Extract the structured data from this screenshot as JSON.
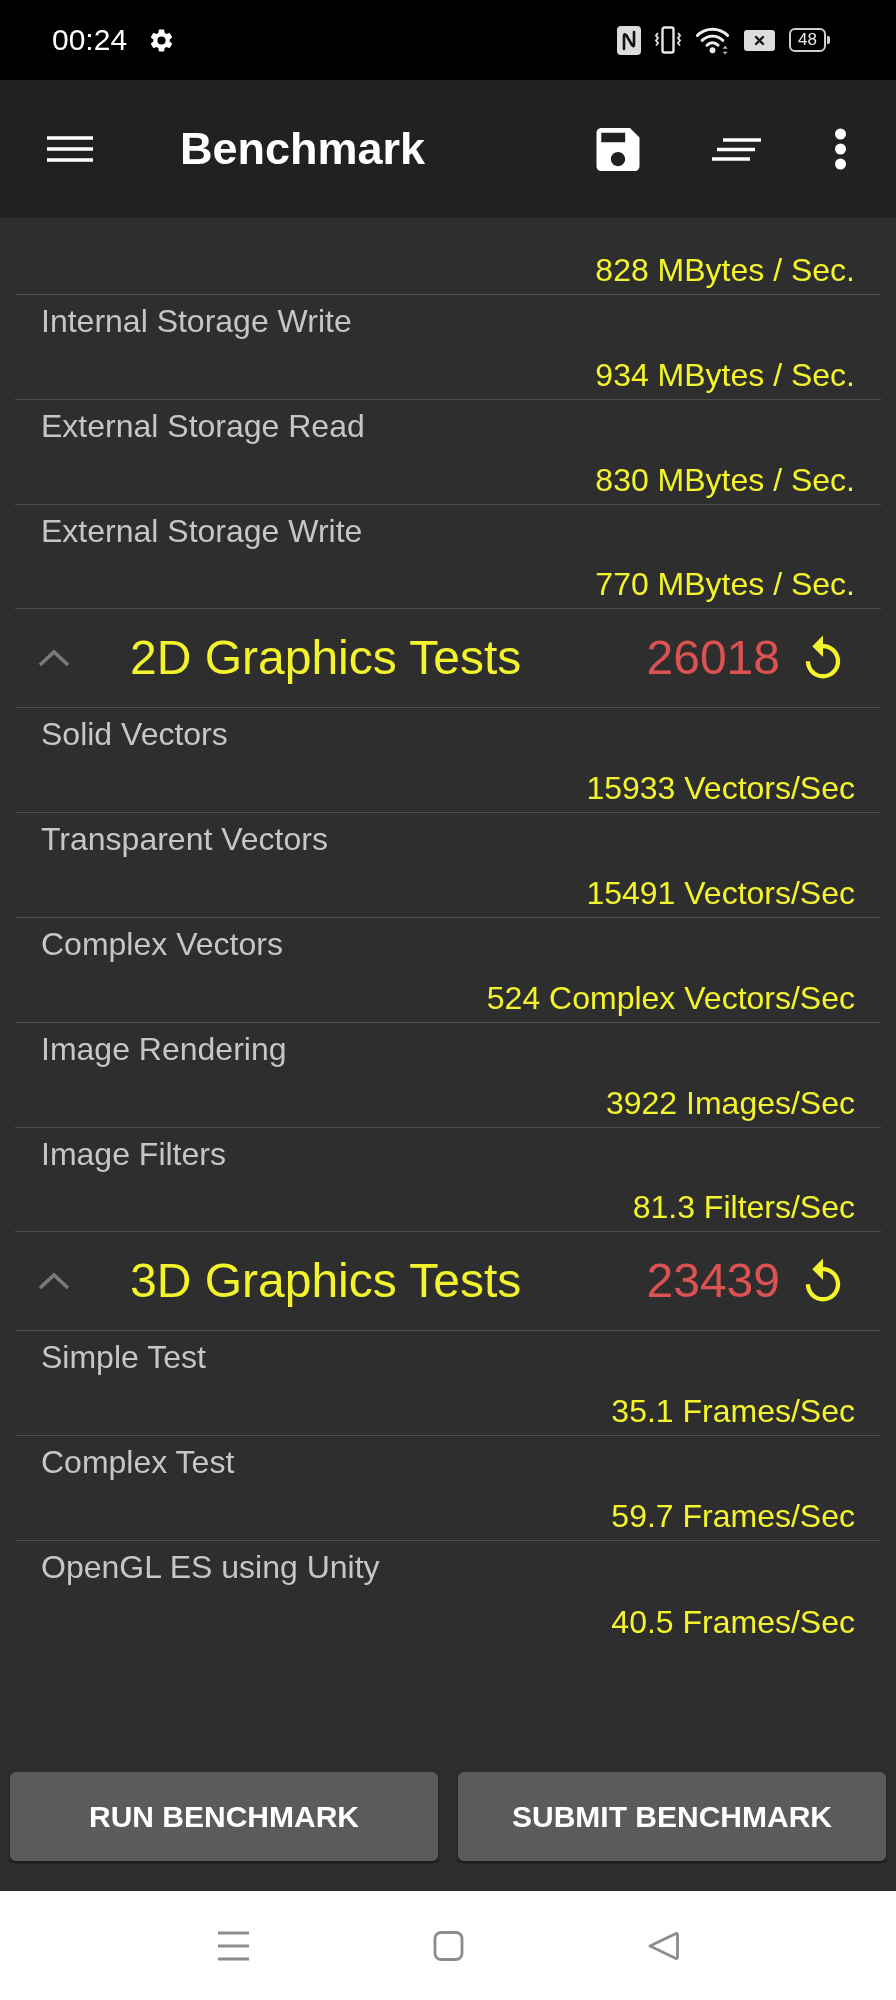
{
  "status_bar": {
    "time": "00:24",
    "battery": "48"
  },
  "app_bar": {
    "title": "Benchmark"
  },
  "sections": [
    {
      "rows": [
        {
          "value": "828 MBytes / Sec."
        },
        {
          "label": "Internal Storage Write",
          "value": "934 MBytes / Sec."
        },
        {
          "label": "External Storage Read",
          "value": "830 MBytes / Sec."
        },
        {
          "label": "External Storage Write",
          "value": "770 MBytes / Sec."
        }
      ]
    },
    {
      "title": "2D Graphics Tests",
      "score": "26018",
      "expanded": true,
      "rows": [
        {
          "label": "Solid Vectors",
          "value": "15933 Vectors/Sec"
        },
        {
          "label": "Transparent Vectors",
          "value": "15491 Vectors/Sec"
        },
        {
          "label": "Complex Vectors",
          "value": "524 Complex Vectors/Sec"
        },
        {
          "label": "Image Rendering",
          "value": "3922 Images/Sec"
        },
        {
          "label": "Image Filters",
          "value": "81.3 Filters/Sec"
        }
      ]
    },
    {
      "title": "3D Graphics Tests",
      "score": "23439",
      "expanded": true,
      "rows": [
        {
          "label": "Simple Test",
          "value": "35.1 Frames/Sec"
        },
        {
          "label": "Complex Test",
          "value": "59.7 Frames/Sec"
        },
        {
          "label": "OpenGL ES using Unity",
          "value": "40.5 Frames/Sec"
        }
      ]
    }
  ],
  "buttons": [
    "RUN BENCHMARK",
    "SUBMIT BENCHMARK"
  ]
}
